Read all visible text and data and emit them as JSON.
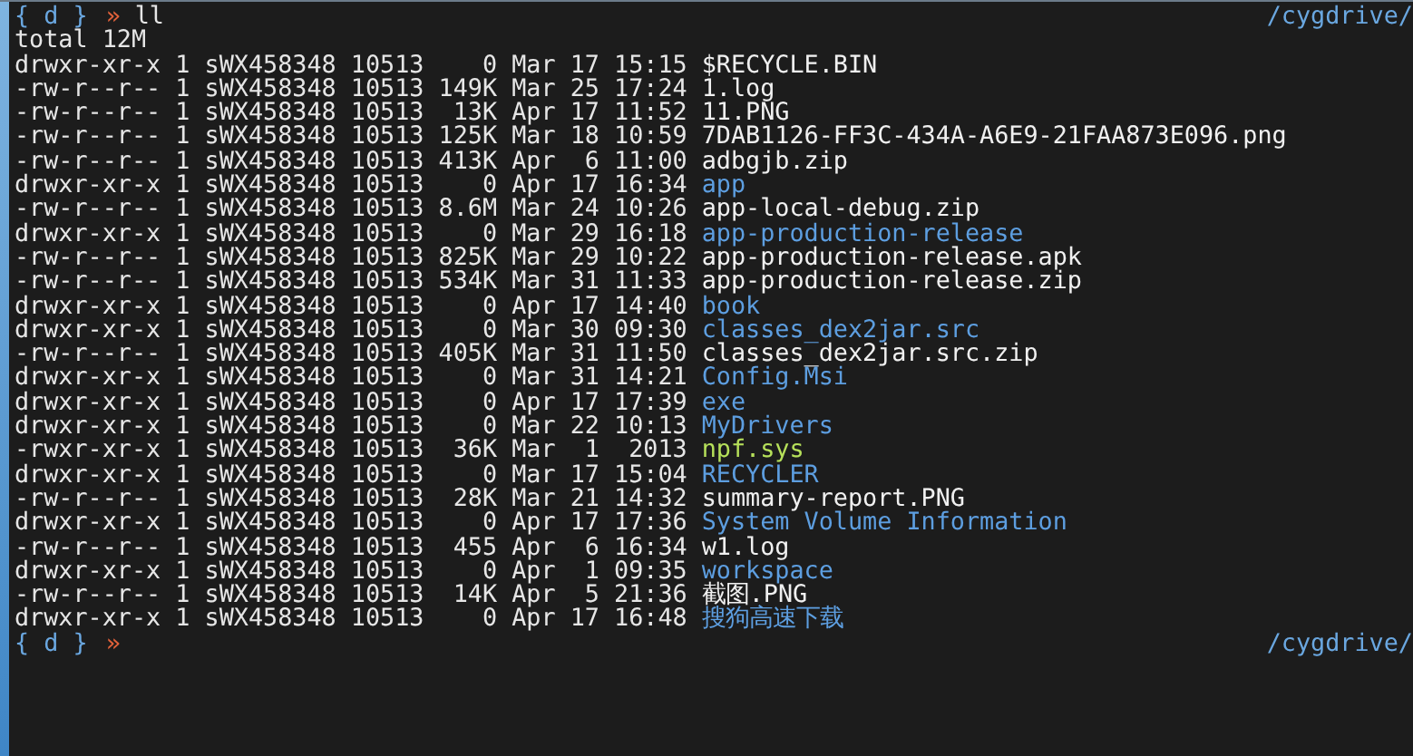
{
  "prompt_top": {
    "cwd": "{ d }",
    "arrow": "»",
    "command": "ll",
    "path": "/cygdrive/"
  },
  "total": "total 12M",
  "listing": [
    {
      "meta": "drwxr-xr-x 1 sWX458348 10513    0 Mar 17 15:15",
      "name": "$RECYCLE.BIN",
      "kind": "file"
    },
    {
      "meta": "-rw-r--r-- 1 sWX458348 10513 149K Mar 25 17:24",
      "name": "1.log",
      "kind": "file"
    },
    {
      "meta": "-rw-r--r-- 1 sWX458348 10513  13K Apr 17 11:52",
      "name": "11.PNG",
      "kind": "file"
    },
    {
      "meta": "-rw-r--r-- 1 sWX458348 10513 125K Mar 18 10:59",
      "name": "7DAB1126-FF3C-434A-A6E9-21FAA873E096.png",
      "kind": "file"
    },
    {
      "meta": "-rw-r--r-- 1 sWX458348 10513 413K Apr  6 11:00",
      "name": "adbgjb.zip",
      "kind": "file"
    },
    {
      "meta": "drwxr-xr-x 1 sWX458348 10513    0 Apr 17 16:34",
      "name": "app",
      "kind": "dir"
    },
    {
      "meta": "-rw-r--r-- 1 sWX458348 10513 8.6M Mar 24 10:26",
      "name": "app-local-debug.zip",
      "kind": "file"
    },
    {
      "meta": "drwxr-xr-x 1 sWX458348 10513    0 Mar 29 16:18",
      "name": "app-production-release",
      "kind": "dir"
    },
    {
      "meta": "-rw-r--r-- 1 sWX458348 10513 825K Mar 29 10:22",
      "name": "app-production-release.apk",
      "kind": "file"
    },
    {
      "meta": "-rw-r--r-- 1 sWX458348 10513 534K Mar 31 11:33",
      "name": "app-production-release.zip",
      "kind": "file"
    },
    {
      "meta": "drwxr-xr-x 1 sWX458348 10513    0 Apr 17 14:40",
      "name": "book",
      "kind": "dir"
    },
    {
      "meta": "drwxr-xr-x 1 sWX458348 10513    0 Mar 30 09:30",
      "name": "classes_dex2jar.src",
      "kind": "dir"
    },
    {
      "meta": "-rw-r--r-- 1 sWX458348 10513 405K Mar 31 11:50",
      "name": "classes_dex2jar.src.zip",
      "kind": "file"
    },
    {
      "meta": "drwxr-xr-x 1 sWX458348 10513    0 Mar 31 14:21",
      "name": "Config.Msi",
      "kind": "dir"
    },
    {
      "meta": "drwxr-xr-x 1 sWX458348 10513    0 Apr 17 17:39",
      "name": "exe",
      "kind": "dir"
    },
    {
      "meta": "drwxr-xr-x 1 sWX458348 10513    0 Mar 22 10:13",
      "name": "MyDrivers",
      "kind": "dir"
    },
    {
      "meta": "-rwxr-xr-x 1 sWX458348 10513  36K Mar  1  2013",
      "name": "npf.sys",
      "kind": "exec"
    },
    {
      "meta": "drwxr-xr-x 1 sWX458348 10513    0 Mar 17 15:04",
      "name": "RECYCLER",
      "kind": "dir"
    },
    {
      "meta": "-rw-r--r-- 1 sWX458348 10513  28K Mar 21 14:32",
      "name": "summary-report.PNG",
      "kind": "file"
    },
    {
      "meta": "drwxr-xr-x 1 sWX458348 10513    0 Apr 17 17:36",
      "name": "System Volume Information",
      "kind": "dir"
    },
    {
      "meta": "-rw-r--r-- 1 sWX458348 10513  455 Apr  6 16:34",
      "name": "w1.log",
      "kind": "file"
    },
    {
      "meta": "drwxr-xr-x 1 sWX458348 10513    0 Apr  1 09:35",
      "name": "workspace",
      "kind": "dir"
    },
    {
      "meta": "-rw-r--r-- 1 sWX458348 10513  14K Apr  5 21:36",
      "name": "截图.PNG",
      "kind": "file"
    },
    {
      "meta": "drwxr-xr-x 1 sWX458348 10513    0 Apr 17 16:48",
      "name": "搜狗高速下载",
      "kind": "dir"
    }
  ],
  "prompt_bottom": {
    "cwd": "{ d }",
    "arrow": "»",
    "path": "/cygdrive/"
  }
}
